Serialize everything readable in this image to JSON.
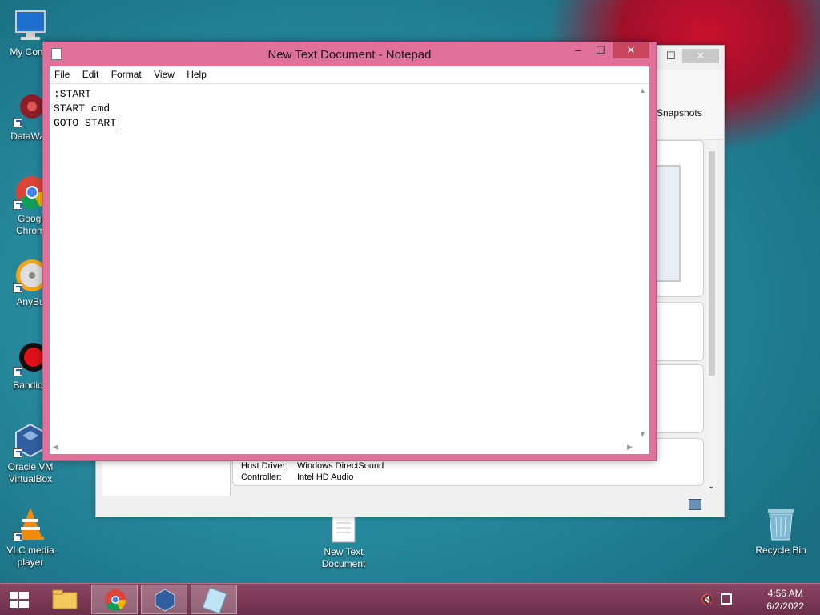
{
  "desktop": {
    "icons": [
      {
        "label": "My Comp"
      },
      {
        "label": "DataWag"
      },
      {
        "label": "Googl Chrom"
      },
      {
        "label": "AnyBu"
      },
      {
        "label": "Bandica"
      },
      {
        "label": "Oracle VM VirtualBox"
      },
      {
        "label": "VLC media player"
      },
      {
        "label": "New Text Document"
      },
      {
        "label": "Recycle Bin"
      }
    ]
  },
  "vbox": {
    "tab_label": "Snapshots",
    "audio": {
      "host_driver_label": "Host Driver:",
      "host_driver_value": "Windows DirectSound",
      "controller_label": "Controller:",
      "controller_value": "Intel HD Audio"
    }
  },
  "notepad": {
    "title": "New Text Document - Notepad",
    "menu": [
      "File",
      "Edit",
      "Format",
      "View",
      "Help"
    ],
    "text": ":START\nSTART cmd\nGOTO START"
  },
  "taskbar": {
    "items": [
      "start-button",
      "file-explorer",
      "google-chrome",
      "virtualbox",
      "notepad"
    ],
    "clock_time": "4:56 AM",
    "clock_date": "6/2/2022"
  },
  "colors": {
    "notepad_frame": "#e0719a",
    "close_button": "#c9465f",
    "taskbar": "#7a3954"
  }
}
